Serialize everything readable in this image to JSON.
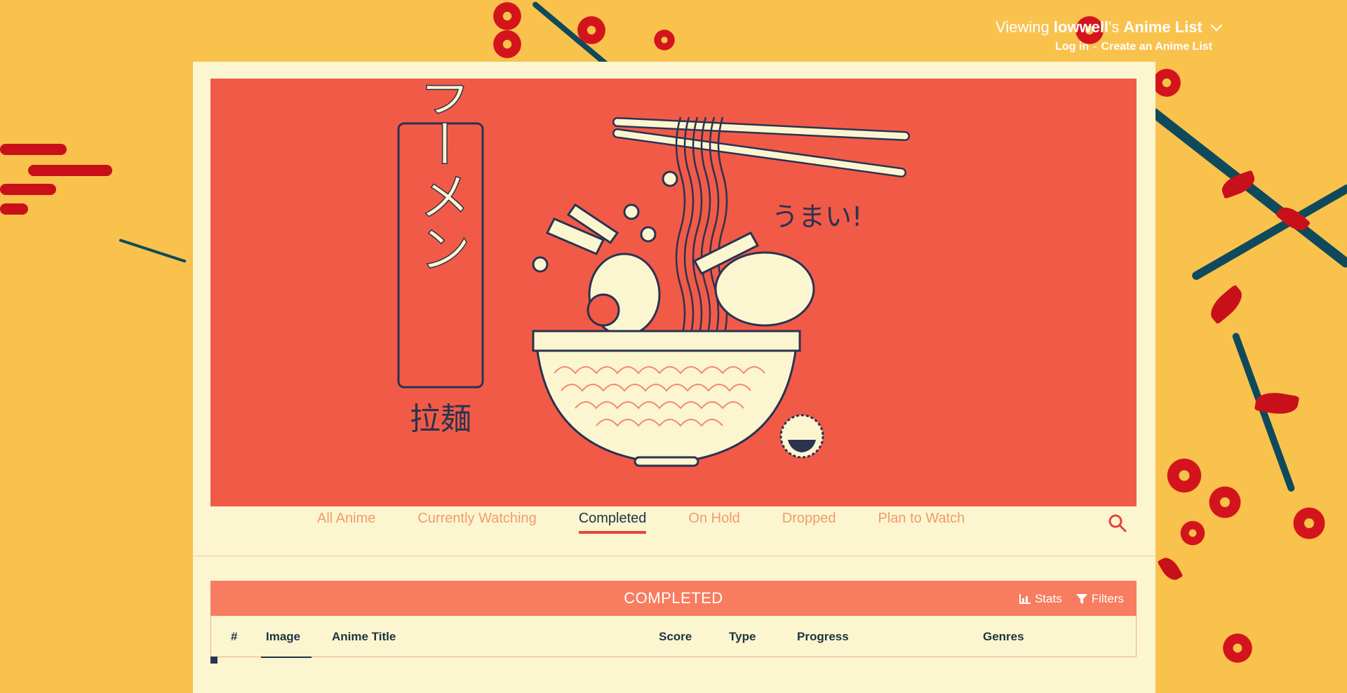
{
  "header": {
    "viewing_prefix": "Viewing",
    "username": "lowwell",
    "possessive": "'s",
    "list_name": "Anime List",
    "login": "Log in",
    "separator": "-",
    "create": "Create an Anime List"
  },
  "banner": {
    "kana_vertical": "ラーメン",
    "kanji": "拉麺",
    "umai": "うまい!"
  },
  "tabs": [
    {
      "label": "All Anime"
    },
    {
      "label": "Currently Watching"
    },
    {
      "label": "Completed",
      "active": true
    },
    {
      "label": "On Hold"
    },
    {
      "label": "Dropped"
    },
    {
      "label": "Plan to Watch"
    }
  ],
  "list": {
    "title": "COMPLETED",
    "stats": "Stats",
    "filters": "Filters",
    "columns": {
      "num": "#",
      "image": "Image",
      "title": "Anime Title",
      "score": "Score",
      "type": "Type",
      "progress": "Progress",
      "genres": "Genres"
    }
  },
  "colors": {
    "accent": "#e6443a",
    "banner": "#f25a48",
    "panel": "#fbf6d0",
    "page": "#f9c24d",
    "list_header": "#f87c5f"
  }
}
